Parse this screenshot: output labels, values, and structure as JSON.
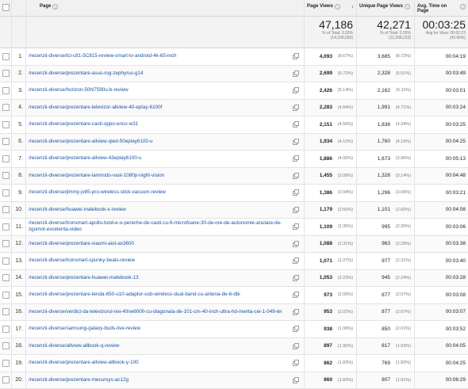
{
  "headers": {
    "page": "Page",
    "page_views": "Page Views",
    "unique_page_views": "Unique Page Views",
    "avg_time": "Avg. Time on Page"
  },
  "totals": {
    "page_views": "47,186",
    "page_views_sub1": "% of Total: 0.33%",
    "page_views_sub2": "(14,105,093)",
    "unique_page_views": "42,271",
    "unique_page_views_sub1": "% of Total: 0.35%",
    "unique_page_views_sub2": "(11,938,233)",
    "avg_time": "00:03:25",
    "avg_time_sub1": "Avg for View: 00:02:23",
    "avg_time_sub2": "(43.90%)"
  },
  "rows": [
    {
      "n": "1.",
      "page": "/recenzii-diverse/tcl-c81-5C815-review-smart-tv-android-4k-65-inch",
      "pv": "4,093",
      "pvp": "(8.67%)",
      "upv": "3,685",
      "upvp": "(8.72%)",
      "avg": "00:04:19"
    },
    {
      "n": "2.",
      "page": "/recenzii-diverse/prezentare-asus-rog-zephyrus-g14",
      "pv": "2,699",
      "pvp": "(5.72%)",
      "upv": "2,328",
      "upvp": "(5.51%)",
      "avg": "00:03:49"
    },
    {
      "n": "3.",
      "page": "/recenzii-diverse/horizon-50hl7590u-b-review",
      "pv": "2,426",
      "pvp": "(5.14%)",
      "upv": "2,162",
      "upvp": "(5.11%)",
      "avg": "00:03:01"
    },
    {
      "n": "4.",
      "page": "/recenzii-diverse/prezentare-televizor-allview-40-eplay-6100f",
      "pv": "2,283",
      "pvp": "(4.84%)",
      "upv": "1,991",
      "upvp": "(4.71%)",
      "avg": "00:03:24"
    },
    {
      "n": "5.",
      "page": "/recenzii-diverse/prezentare-casti-oppo-enco-w31",
      "pv": "2,151",
      "pvp": "(4.56%)",
      "upv": "1,836",
      "upvp": "(4.34%)",
      "avg": "00:03:25"
    },
    {
      "n": "6.",
      "page": "/recenzii-diverse/prezentare-allview-qled-50eplay6100-u",
      "pv": "1,934",
      "pvp": "(4.10%)",
      "upv": "1,760",
      "upvp": "(4.16%)",
      "avg": "00:04:25"
    },
    {
      "n": "7.",
      "page": "/recenzii-diverse/prezentare-allview-43eplay6100-u",
      "pv": "1,886",
      "pvp": "(4.00%)",
      "upv": "1,673",
      "upvp": "(3.96%)",
      "avg": "00:05:13"
    },
    {
      "n": "8.",
      "page": "/recenzii-diverse/prezentare-lanmodo-vast-1080p-night-vision",
      "pv": "1,455",
      "pvp": "(3.08%)",
      "upv": "1,328",
      "upvp": "(3.14%)",
      "avg": "00:04:48"
    },
    {
      "n": "9.",
      "page": "/recenzii-diverse/jimmy-jv85-pro-wireless-stick-vacuum-review",
      "pv": "1,386",
      "pvp": "(2.94%)",
      "upv": "1,296",
      "upvp": "(3.06%)",
      "avg": "00:03:21"
    },
    {
      "n": "10.",
      "page": "/recenzii-diverse/huawei-matebook-x-review",
      "pv": "1,179",
      "pvp": "(2.50%)",
      "upv": "1,101",
      "upvp": "(2.60%)",
      "avg": "00:04:08"
    },
    {
      "n": "11.",
      "page": "/recenzii-diverse/tronsmart-apollo-bold-e-o-pereche-de-casti-cu-6-microfoane-30-de-ore-de-autonomie-anulare-de-zgomot-excelenta-video",
      "pv": "1,109",
      "pvp": "(2.35%)",
      "upv": "995",
      "upvp": "(2.35%)",
      "avg": "00:03:06"
    },
    {
      "n": "12.",
      "page": "/recenzii-diverse/prezentare-xiaomi-aiot-ax3600",
      "pv": "1,088",
      "pvp": "(2.31%)",
      "upv": "963",
      "upvp": "(2.28%)",
      "avg": "00:03:38"
    },
    {
      "n": "13.",
      "page": "/recenzii-diverse/tronsmart-spunky-beats-review",
      "pv": "1,071",
      "pvp": "(2.27%)",
      "upv": "977",
      "upvp": "(2.31%)",
      "avg": "00:03:40"
    },
    {
      "n": "14.",
      "page": "/recenzii-diverse/prezentare-huawei-matebook-13",
      "pv": "1,053",
      "pvp": "(2.23%)",
      "upv": "945",
      "upvp": "(2.24%)",
      "avg": "00:03:28"
    },
    {
      "n": "15.",
      "page": "/recenzii-diverse/prezentare-tenda-650-u10-adaptor-usb-wireless-dual-band-cu-antena-de-6-dbi",
      "pv": "973",
      "pvp": "(2.06%)",
      "upv": "877",
      "upvp": "(2.07%)",
      "avg": "00:03:08"
    },
    {
      "n": "16.",
      "page": "/recenzii-diverse/verdict-da-televizorul-nei-40ne6000-cu-diagonala-de-101-cm-40-inch-ultra-hd-merita-cei-1-049-lei",
      "pv": "953",
      "pvp": "(2.02%)",
      "upv": "877",
      "upvp": "(2.07%)",
      "avg": "00:03:07"
    },
    {
      "n": "17.",
      "page": "/recenzii-diverse/samsung-galaxy-buds-live-review",
      "pv": "938",
      "pvp": "(1.99%)",
      "upv": "850",
      "upvp": "(2.01%)",
      "avg": "00:03:52"
    },
    {
      "n": "18.",
      "page": "/recenzii-diverse/allview-allbook-q-review",
      "pv": "897",
      "pvp": "(1.90%)",
      "upv": "817",
      "upvp": "(1.93%)",
      "avg": "00:04:05"
    },
    {
      "n": "19.",
      "page": "/recenzii-diverse/prezentare-allview-allbook-y-100",
      "pv": "862",
      "pvp": "(1.83%)",
      "upv": "769",
      "upvp": "(1.82%)",
      "avg": "00:04:25"
    },
    {
      "n": "20.",
      "page": "/recenzii-diverse/prezentare-mecursys-ac12g",
      "pv": "860",
      "pvp": "(1.82%)",
      "upv": "807",
      "upvp": "(1.91%)",
      "avg": "00:06:29"
    }
  ],
  "colors": {
    "link": "#1a53a8",
    "header_bg": "#f1f1f1",
    "border": "#e3e3e3"
  }
}
